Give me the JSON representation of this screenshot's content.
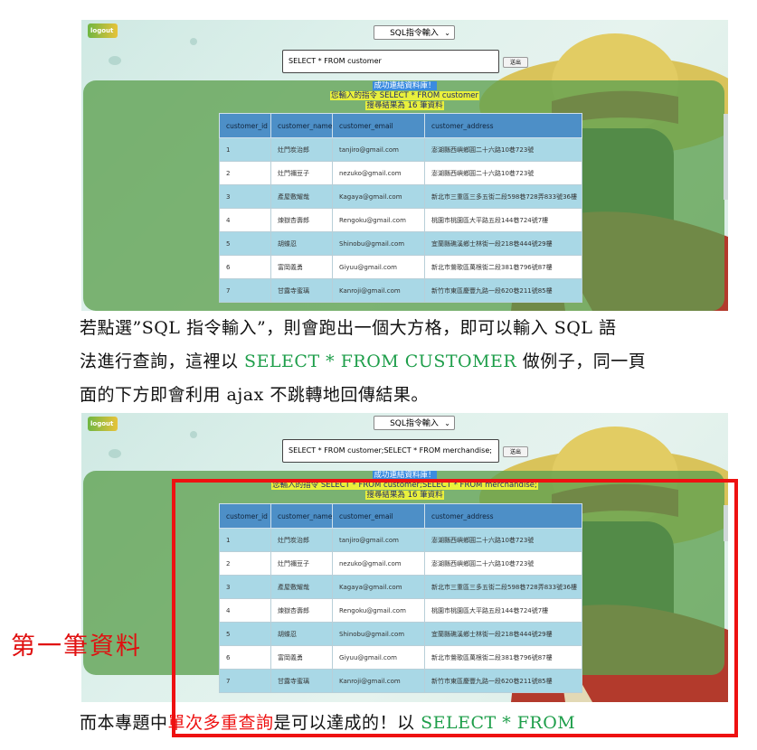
{
  "screenshot1": {
    "logout_label": "logout",
    "select_value": "SQL指令輸入",
    "query_input": "SELECT * FROM customer",
    "send_label": "送出",
    "msg_success": "成功連結資料庫！",
    "msg_command": "您輸入的指令 SELECT * FROM customer",
    "msg_count": "搜尋結果為 16 筆資料"
  },
  "screenshot2": {
    "logout_label": "logout",
    "select_value": "SQL指令輸入",
    "query_input": "SELECT * FROM customer;SELECT * FROM merchandise;",
    "send_label": "送出",
    "msg_success": "成功連結資料庫！",
    "msg_command": "您輸入的指令 SELECT * FROM customer;SELECT * FROM merchandise;",
    "msg_count": "搜尋結果為 16 筆資料"
  },
  "table": {
    "headers": [
      "customer_id",
      "customer_name",
      "customer_email",
      "customer_address"
    ],
    "rows": [
      [
        "1",
        "灶門炭治郎",
        "tanjiro@gmail.com",
        "澎湖縣西嶼鄉圓二十六路10巷723號"
      ],
      [
        "2",
        "灶門禰豆子",
        "nezuko@gmail.com",
        "澎湖縣西嶼鄉圓二十六路10巷723號"
      ],
      [
        "3",
        "產屋敷耀哉",
        "Kagaya@gmail.com",
        "新北市三重區三多五街二段598巷728弄833號36樓"
      ],
      [
        "4",
        "煉獄杏壽郎",
        "Rengoku@gmail.com",
        "桃園市桃園區大平路五段144巷724號7樓"
      ],
      [
        "5",
        "胡蝶忍",
        "Shinobu@gmail.com",
        "宜蘭縣礁溪鄉士林街一段218巷444號29樓"
      ],
      [
        "6",
        "富岡義勇",
        "Giyuu@gmail.com",
        "新北市鶯歌區萬根街二段381巷796號87樓"
      ],
      [
        "7",
        "甘露寺蜜璃",
        "Kanroji@gmail.com",
        "新竹市東區慶豐九路一段620巷211號85樓"
      ]
    ]
  },
  "paragraph1": {
    "line1": "若點選”SQL 指令輸入”，則會跑出一個大方格，即可以輸入 SQL 語",
    "line2_a": "法進行查詢，這裡以 ",
    "line2_code": "SELECT * FROM CUSTOMER",
    "line2_b": " 做例子，同一頁",
    "line3": "面的下方即會利用 ajax 不跳轉地回傳結果。"
  },
  "annotation": {
    "first_record_label": "第一筆資料"
  },
  "paragraph2": {
    "part_a": "而本專題中",
    "part_red": "單次多重查詢",
    "part_b": "是可以達成的！以 ",
    "part_code": "SELECT * FROM"
  },
  "colors": {
    "accent_green": "#1e9e4a",
    "highlight_red": "#ee1111",
    "table_header": "#4d8fc7",
    "table_row_alt": "#a9d8e6"
  }
}
